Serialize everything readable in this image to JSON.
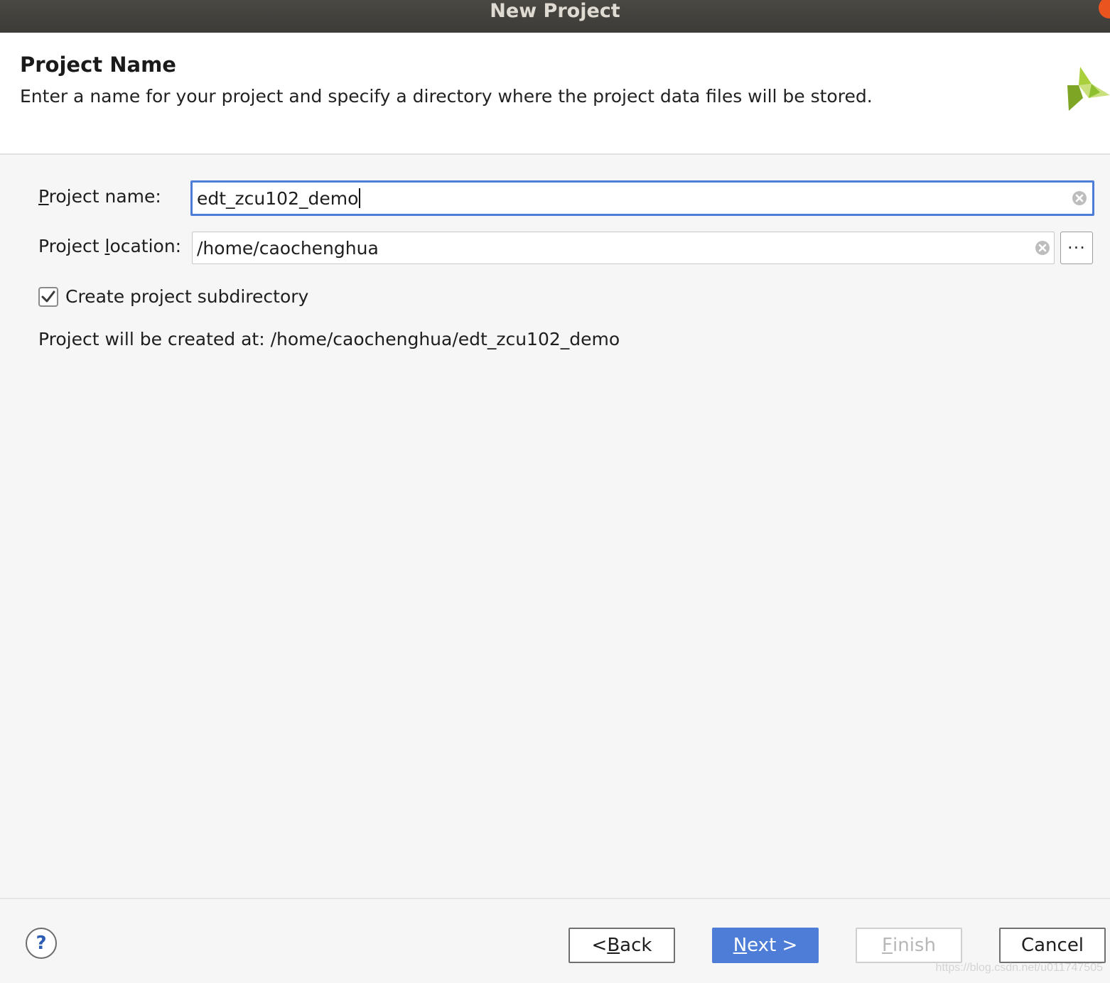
{
  "window": {
    "title": "New Project"
  },
  "header": {
    "heading": "Project Name",
    "description": "Enter a name for your project and specify a directory where the project data files will be stored."
  },
  "form": {
    "project_name": {
      "label_mnemonic": "P",
      "label_rest": "roject name:",
      "value": "edt_zcu102_demo"
    },
    "project_location": {
      "label_prefix": "Project ",
      "label_mnemonic": "l",
      "label_rest": "ocation:",
      "value": "/home/caochenghua",
      "browse_label": "···"
    },
    "subdirectory": {
      "label": "Create project subdirectory",
      "checked": true
    },
    "created_at": "Project will be created at: /home/caochenghua/edt_zcu102_demo"
  },
  "footer": {
    "help_label": "?",
    "back": {
      "prefix": "< ",
      "mnemonic": "B",
      "rest": "ack"
    },
    "next": {
      "mnemonic": "N",
      "rest": "ext >"
    },
    "finish": {
      "mnemonic": "F",
      "rest": "inish"
    },
    "cancel": "Cancel"
  },
  "watermark": "https://blog.csdn.net/u011747505",
  "colors": {
    "accent": "#4d7dd6",
    "titlebar": "#3c3b37",
    "logo_green": "#8dbf2e"
  },
  "icons": [
    "logo-icon",
    "clear-icon",
    "check-icon",
    "help-icon",
    "close-icon"
  ]
}
